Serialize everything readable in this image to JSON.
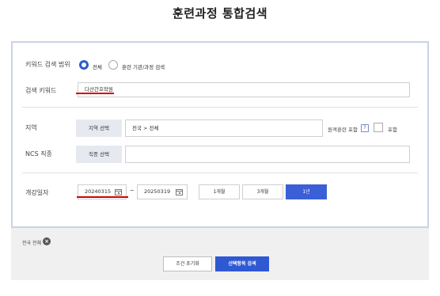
{
  "title": "훈련과정 통합검색",
  "search_scope": {
    "label": "키워드 검색 범위",
    "options": [
      {
        "label": "전체",
        "selected": true
      },
      {
        "label": "훈련 기관/과정 검색",
        "selected": false
      }
    ]
  },
  "keyword": {
    "label": "검색 키워드",
    "value": "다산간호학원"
  },
  "region": {
    "label": "지역",
    "button": "지역 선택",
    "value": "전국 > 전체",
    "remote_label": "원격훈련 포함",
    "help": "?",
    "include_label": "포함"
  },
  "ncs": {
    "label": "NCS 직종",
    "button": "직종 선택",
    "value": ""
  },
  "date": {
    "label": "개강일자",
    "start": "20240315",
    "separator": "~",
    "end": "20250319",
    "periods": [
      {
        "label": "1개월",
        "active": false
      },
      {
        "label": "3개월",
        "active": false
      },
      {
        "label": "1년",
        "active": true
      }
    ]
  },
  "footer": {
    "chip_label": "전국 전체",
    "close": "×",
    "reset_label": "조건 초기화",
    "search_label": "선택항목 검색"
  },
  "colors": {
    "accent": "#2f59d3",
    "highlight": "#d40000",
    "panel_border": "#c9d3e6"
  }
}
